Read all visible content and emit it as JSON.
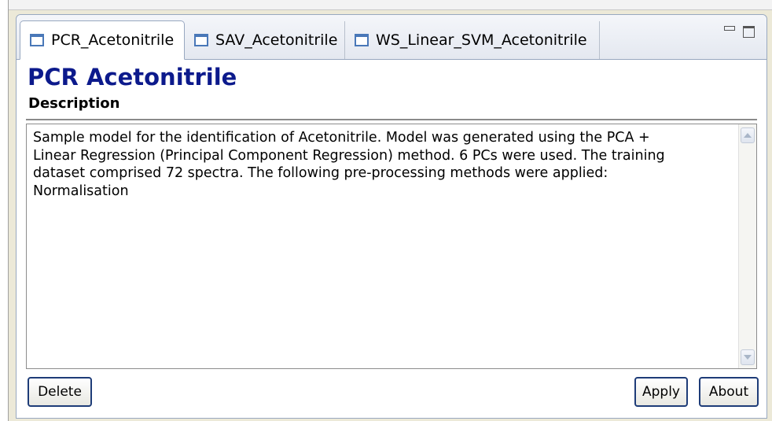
{
  "tabs": [
    {
      "label": "PCR_Acetonitrile",
      "active": true
    },
    {
      "label": "SAV_Acetonitrile",
      "active": false
    },
    {
      "label": "WS_Linear_SVM_Acetonitrile",
      "active": false
    }
  ],
  "window_controls": {
    "minimize_icon": "minimize-icon",
    "maximize_icon": "maximize-icon"
  },
  "page": {
    "title": "PCR Acetonitrile",
    "section_label": "Description"
  },
  "description": {
    "text": "Sample model for the identification of Acetonitrile. Model was generated using the PCA +\nLinear Regression (Principal Component Regression) method. 6 PCs were used. The training\ndataset comprised 72 spectra. The following pre-processing methods were applied:\nNormalisation"
  },
  "buttons": {
    "delete_label": "Delete",
    "apply_label": "Apply",
    "about_label": "About"
  },
  "colors": {
    "title": "#0c1a8c",
    "button_border": "#1e3c78",
    "tab_icon": "#4a78b8"
  }
}
